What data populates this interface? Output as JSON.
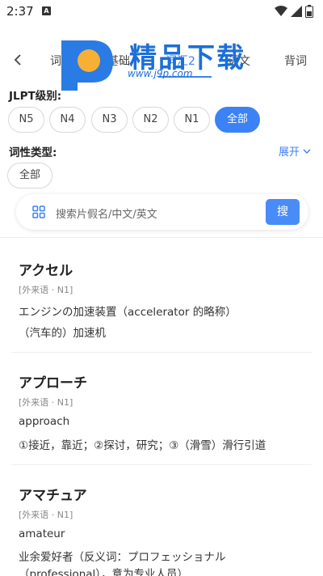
{
  "status": {
    "time": "2:37",
    "notif_letter": "A"
  },
  "header": {
    "back_label": "‹",
    "tabs": [
      {
        "label": "词汇"
      },
      {
        "label": "基础"
      },
      {
        "label": "词汇2"
      },
      {
        "label": "语文"
      },
      {
        "label": "背词"
      }
    ],
    "active_tab": 2
  },
  "watermark": {
    "brand": "精品下载",
    "url": "www.j9p.com"
  },
  "jlpt": {
    "title": "JLPT级别:",
    "levels": [
      "N5",
      "N4",
      "N3",
      "N2",
      "N1",
      "全部"
    ],
    "selected": "全部"
  },
  "pos": {
    "title": "词性类型:",
    "expand_label": "展开",
    "options": [
      "全部"
    ]
  },
  "search": {
    "placeholder": "搜索片假名/中文/英文",
    "button_label": "搜"
  },
  "entries": [
    {
      "word": "アクセル",
      "tag": "[外来语 · N1]",
      "lines": [
        "エンジンの加速装置（accelerator 的略称）",
        "（汽车的）加速机"
      ]
    },
    {
      "word": "アプローチ",
      "tag": "[外来语 · N1]",
      "lines": [
        "approach",
        "①接近，靠近；②探讨，研究；③（滑雪）滑行引道"
      ]
    },
    {
      "word": "アマチュア",
      "tag": "[外来语 · N1]",
      "lines": [
        "amateur",
        "业余爱好者（反义词：プロフェッショナル",
        "（professional），意为专业人员）"
      ]
    }
  ],
  "colors": {
    "accent": "#3b82f6",
    "brand": "#1c6fd8",
    "orange": "#f7b034"
  }
}
